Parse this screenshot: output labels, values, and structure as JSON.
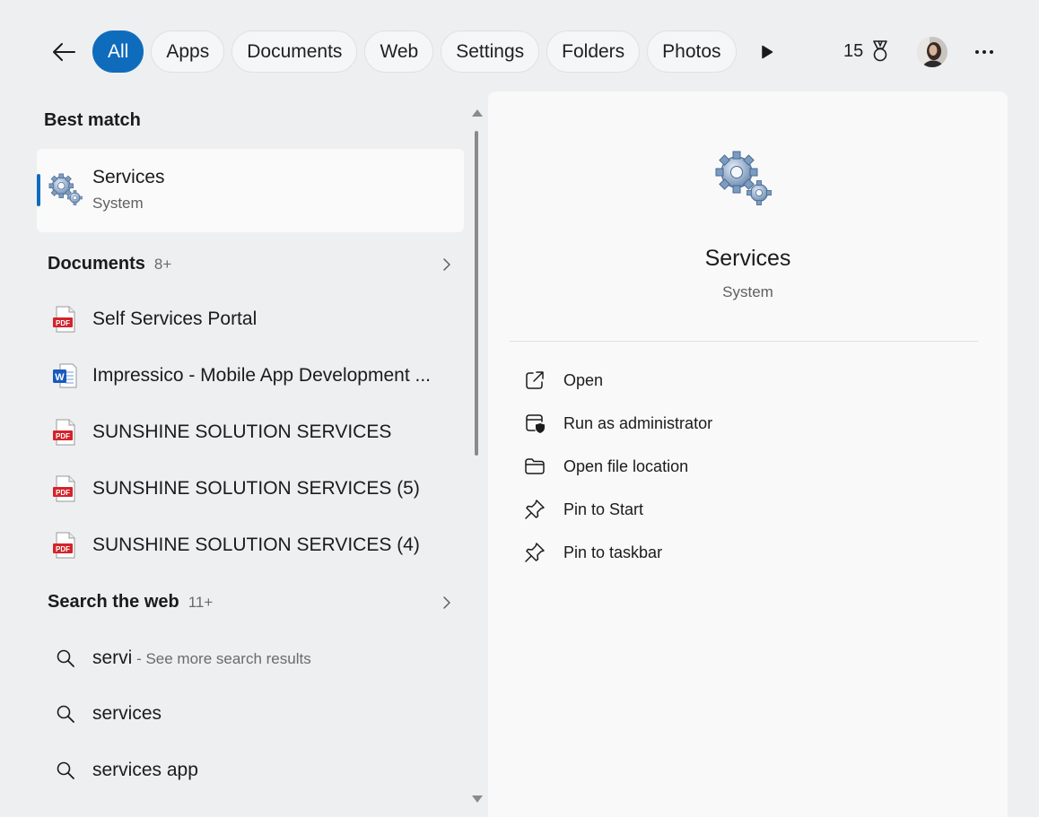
{
  "topbar": {
    "tabs": [
      {
        "label": "All"
      },
      {
        "label": "Apps"
      },
      {
        "label": "Documents"
      },
      {
        "label": "Web"
      },
      {
        "label": "Settings"
      },
      {
        "label": "Folders"
      },
      {
        "label": "Photos"
      }
    ],
    "points": "15",
    "accent_color": "#0f6cbd"
  },
  "results": {
    "best_match": {
      "title": "Best match",
      "item": {
        "name": "Services",
        "type": "System",
        "icon": "gears-icon"
      }
    },
    "documents": {
      "title": "Documents",
      "count": "8+",
      "items": [
        {
          "name": "Self Services Portal",
          "icon": "pdf-icon"
        },
        {
          "name": "Impressico - Mobile App Development ...",
          "icon": "word-icon"
        },
        {
          "name": "SUNSHINE SOLUTION SERVICES",
          "icon": "pdf-icon"
        },
        {
          "name": "SUNSHINE SOLUTION SERVICES (5)",
          "icon": "pdf-icon"
        },
        {
          "name": "SUNSHINE SOLUTION SERVICES (4)",
          "icon": "pdf-icon"
        }
      ]
    },
    "web": {
      "title": "Search the web",
      "count": "11+",
      "items": [
        {
          "query": "servi",
          "hint": " - See more search results"
        },
        {
          "query": "services",
          "hint": ""
        },
        {
          "query": "services app",
          "hint": ""
        }
      ]
    }
  },
  "preview": {
    "name": "Services",
    "type": "System",
    "actions": [
      {
        "label": "Open",
        "icon": "open-external-icon"
      },
      {
        "label": "Run as administrator",
        "icon": "shield-window-icon"
      },
      {
        "label": "Open file location",
        "icon": "folder-icon"
      },
      {
        "label": "Pin to Start",
        "icon": "pin-icon"
      },
      {
        "label": "Pin to taskbar",
        "icon": "pin-icon"
      }
    ]
  }
}
